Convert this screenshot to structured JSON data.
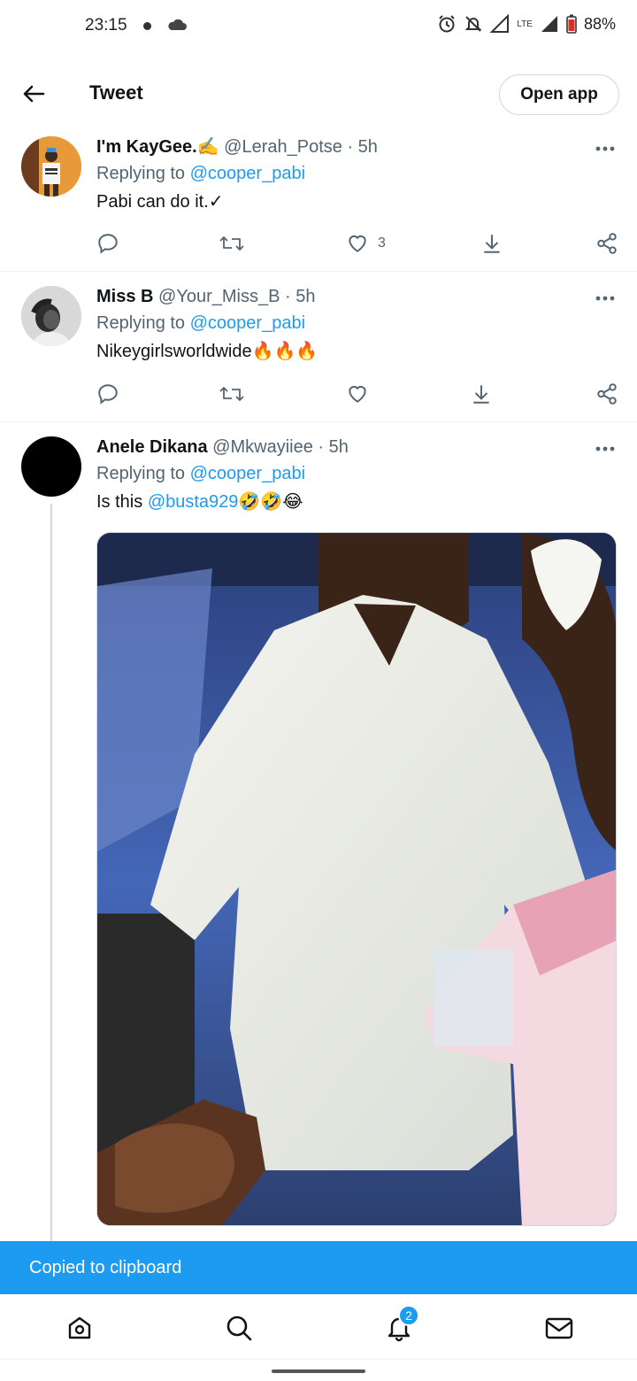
{
  "status_bar": {
    "time": "23:15",
    "network": "LTE",
    "battery": "88%"
  },
  "header": {
    "title": "Tweet",
    "open_app_label": "Open app"
  },
  "tweets": [
    {
      "name": "I'm KayGee.✍️",
      "handle": "@Lerah_Potse",
      "time": "· 5h",
      "replying_prefix": "Replying to",
      "replying_to": "@cooper_pabi",
      "text": "Pabi can do it.✓",
      "like_count": "3"
    },
    {
      "name": "Miss B",
      "handle": "@Your_Miss_B",
      "time": "· 5h",
      "replying_prefix": "Replying to",
      "replying_to": "@cooper_pabi",
      "text": "Nikeygirlsworldwide🔥🔥🔥"
    },
    {
      "name": "Anele Dikana",
      "handle": "@Mkwayiiee",
      "time": "· 5h",
      "replying_prefix": "Replying to",
      "replying_to": "@cooper_pabi",
      "text_prefix": "Is this",
      "text_mention": "@busta929",
      "text_suffix": "🤣🤣😂"
    }
  ],
  "snackbar": {
    "message": "Copied to clipboard"
  },
  "bottom_nav": {
    "notification_count": "2"
  },
  "colors": {
    "accent": "#1d9bf0",
    "text": "#0f1419",
    "secondary": "#536471"
  }
}
